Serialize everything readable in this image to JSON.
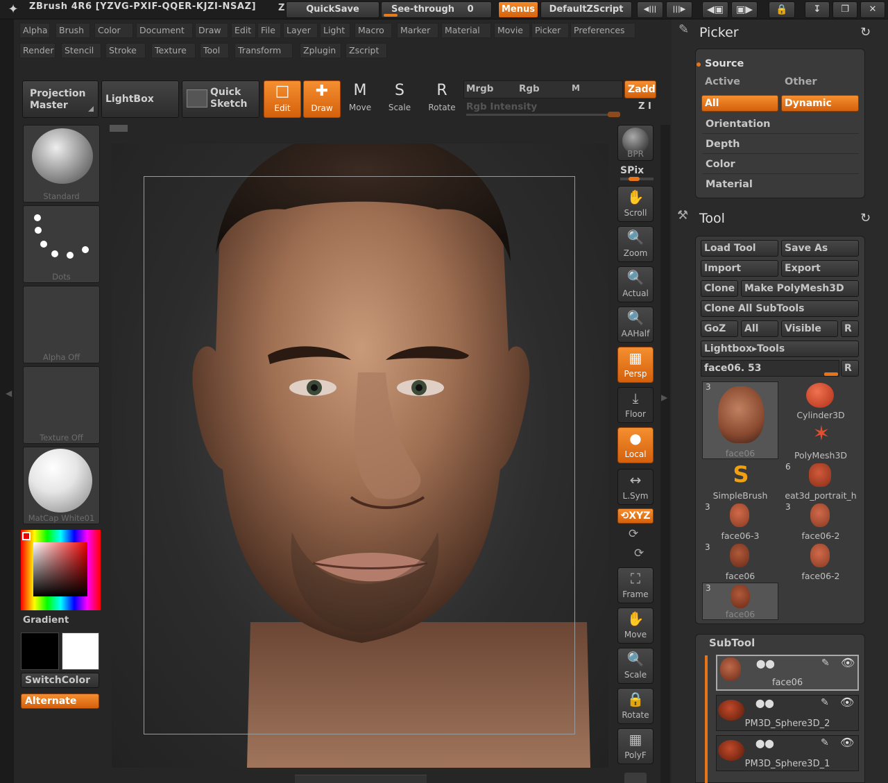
{
  "titlebar": {
    "title": "ZBrush 4R6 [YZVG-PXIF-QQER-KJZI-NSAZ]",
    "z_glyph": "Z",
    "quicksave": "QuickSave",
    "seethrough": "See-through",
    "seethrough_value": "0",
    "menus": "Menus",
    "script": "DefaultZScript"
  },
  "menus_row1": [
    "Alpha",
    "Brush",
    "Color",
    "Document",
    "Draw",
    "Edit",
    "File",
    "Layer",
    "Light",
    "Macro",
    "Marker",
    "Material",
    "Movie",
    "Picker",
    "Preferences"
  ],
  "menus_row2": [
    "Render",
    "Stencil",
    "Stroke",
    "Texture",
    "Tool",
    "Transform",
    "Zplugin",
    "Zscript"
  ],
  "toolbar": {
    "projection_master": "Projection Master",
    "lightbox": "LightBox",
    "quick_sketch": "Quick Sketch",
    "edit": "Edit",
    "draw": "Draw",
    "move": "Move",
    "scale": "Scale",
    "rotate": "Rotate",
    "move_glyph": "M",
    "scale_glyph": "S",
    "rotate_glyph": "R",
    "mrgb": "Mrgb",
    "rgb": "Rgb",
    "m": "M",
    "zadd": "Zadd",
    "rgb_intensity": "Rgb Intensity",
    "z_intensity": "Z I"
  },
  "left_shelf": {
    "brush": "Standard",
    "stroke": "Dots",
    "alpha": "Alpha Off",
    "texture": "Texture Off",
    "material": "MatCap White01",
    "gradient": "Gradient",
    "switchcolor": "SwitchColor",
    "alternate": "Alternate"
  },
  "right_shelf": {
    "bpr": "BPR",
    "spix": "SPix",
    "scroll": "Scroll",
    "zoom": "Zoom",
    "actual": "Actual",
    "aahalf": "AAHalf",
    "persp": "Persp",
    "floor": "Floor",
    "local": "Local",
    "lsym": "L.Sym",
    "xyz": "XYZ",
    "frame": "Frame",
    "move": "Move",
    "scale": "Scale",
    "rotate": "Rotate",
    "polyf": "PolyF"
  },
  "picker": {
    "title": "Picker",
    "source": "Source",
    "active": "Active",
    "other": "Other",
    "all": "All",
    "dynamic": "Dynamic",
    "orientation": "Orientation",
    "depth": "Depth",
    "color": "Color",
    "material": "Material"
  },
  "tool": {
    "title": "Tool",
    "load_tool": "Load Tool",
    "save_as": "Save As",
    "import": "Import",
    "export": "Export",
    "clone": "Clone",
    "make_polymesh": "Make PolyMesh3D",
    "clone_all": "Clone All SubTools",
    "goz": "GoZ",
    "all": "All",
    "visible": "Visible",
    "r": "R",
    "lightbox_tools": "Lightbox▸Tools",
    "current_tool": "face06. 53",
    "thumbs": [
      {
        "name": "face06",
        "count": "3"
      },
      {
        "name": "Cylinder3D",
        "count": ""
      },
      {
        "name": "PolyMesh3D",
        "count": ""
      },
      {
        "name": "SimpleBrush",
        "count": ""
      },
      {
        "name": "eat3d_portrait_h",
        "count": "6"
      },
      {
        "name": "face06-3",
        "count": "3"
      },
      {
        "name": "face06-2",
        "count": "3"
      },
      {
        "name": "face06",
        "count": "3"
      },
      {
        "name": "face06-2",
        "count": ""
      },
      {
        "name": "face06",
        "count": "3"
      }
    ]
  },
  "subtool": {
    "title": "SubTool",
    "items": [
      "face06",
      "PM3D_Sphere3D_2",
      "PM3D_Sphere3D_1"
    ]
  },
  "colors": {
    "accent": "#e8741a",
    "panel": "#3a3a3a",
    "background": "#262626"
  }
}
